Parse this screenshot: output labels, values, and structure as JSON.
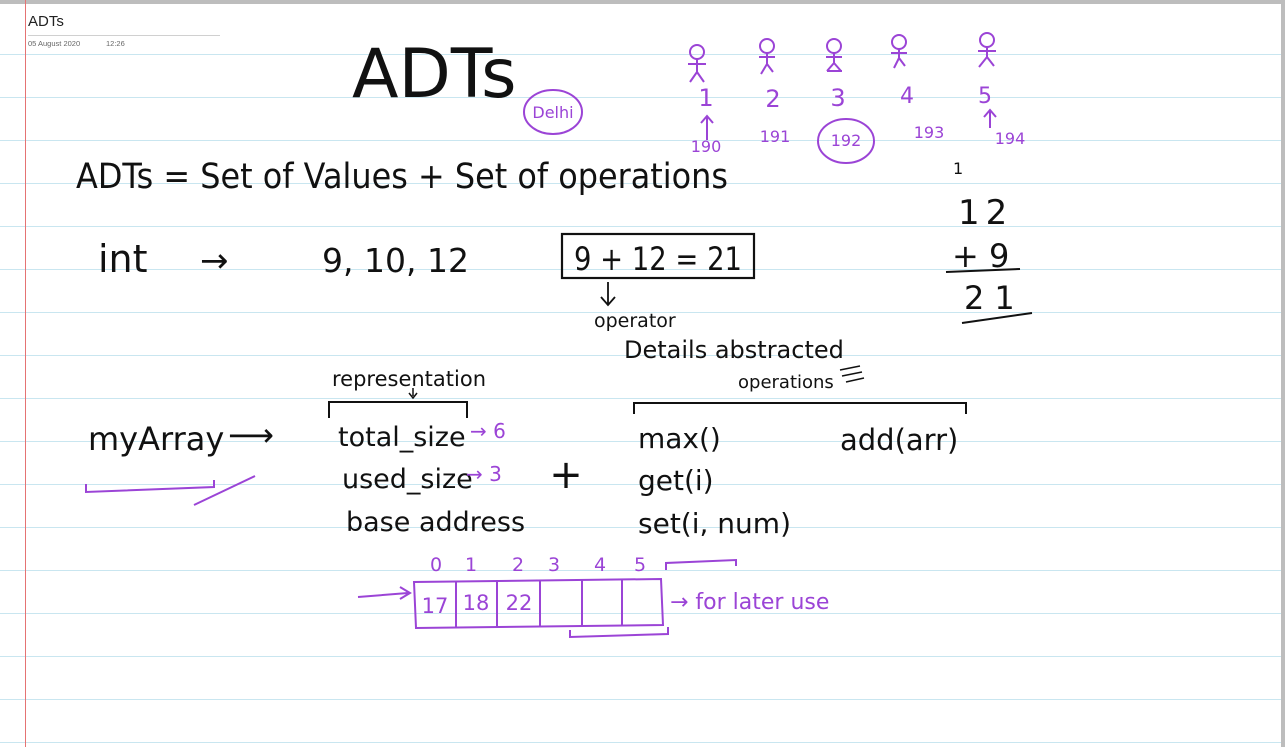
{
  "page": {
    "title": "ADTs",
    "date": "05 August 2020",
    "time": "12:26"
  },
  "ink_colors": {
    "black": "#111111",
    "purple": "#9b44d6"
  },
  "heading": "ADTs",
  "city_label": "Delhi",
  "figures": {
    "numbers": [
      "1",
      "2",
      "3",
      "4",
      "5"
    ],
    "codes": [
      "190",
      "191",
      "192",
      "193",
      "194"
    ]
  },
  "definition": "ADTs = Set of Values + Set of operations",
  "int_row": {
    "label": "int",
    "arrow": "→",
    "values": "9, 10, 12",
    "expression": "9 + 12 = 21"
  },
  "operator_notes": {
    "operator": "operator",
    "details": "Details abstracted"
  },
  "vertical_sum": {
    "carry": "1",
    "top": "12",
    "addend": "+ 9",
    "result": "21"
  },
  "representation": {
    "label": "representation",
    "items": [
      "total_size",
      "used_size",
      "base address"
    ],
    "item_values": [
      "→ 6",
      "→ 3"
    ]
  },
  "myarray": {
    "label": "myArray",
    "arrow": "⟶"
  },
  "plus": "+",
  "operations": {
    "label": "operations",
    "items": [
      "max()",
      "get(i)",
      "set(i, num)"
    ],
    "extra": "add(arr)"
  },
  "array_diagram": {
    "indices": [
      "0",
      "1",
      "2",
      "3",
      "4",
      "5"
    ],
    "cells": [
      "17",
      "18",
      "22",
      "",
      "",
      ""
    ],
    "note": "→ for later use"
  }
}
